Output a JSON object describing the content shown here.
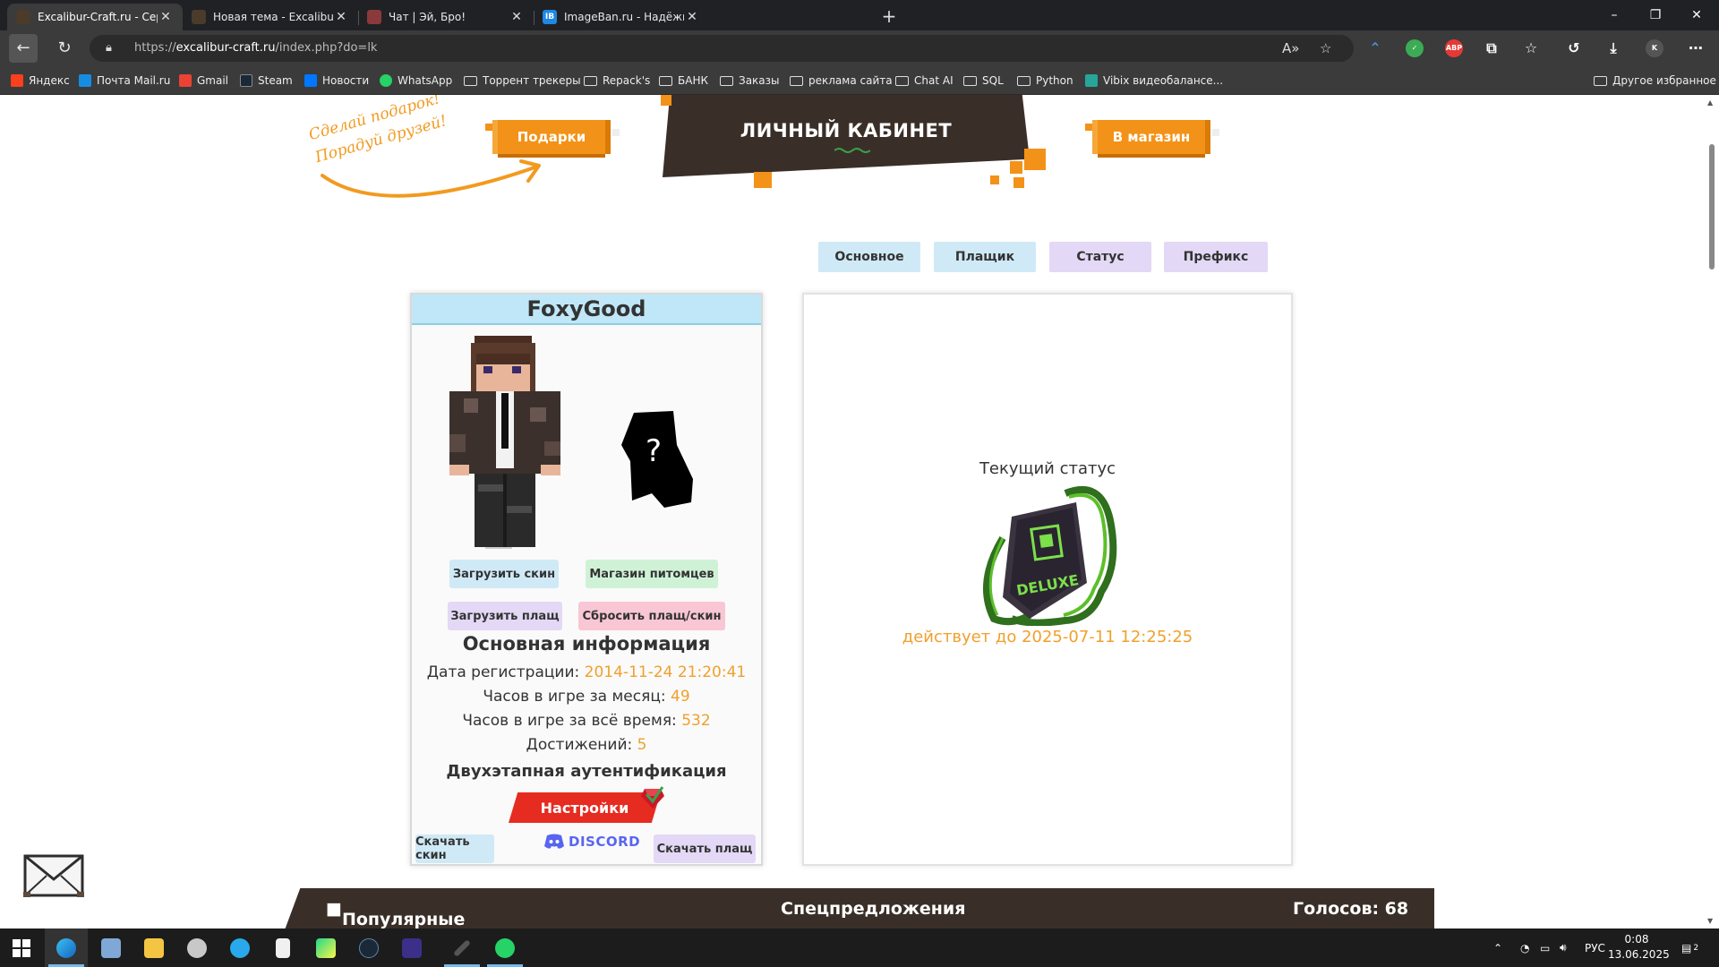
{
  "browser": {
    "tabs": [
      {
        "title": "Excalibur-Craft.ru - Сервера Mai",
        "active": true
      },
      {
        "title": "Новая тема - Excalibur Craft фор",
        "active": false
      },
      {
        "title": "Чат | Эй, Бро!",
        "active": false
      },
      {
        "title": "ImageBan.ru - Надёжный фотох",
        "active": false
      }
    ],
    "new_tab_glyph": "+",
    "window_controls": {
      "minimize": "–",
      "restore": "❐",
      "close": "✕"
    },
    "address": {
      "scheme": "https://",
      "host": "excalibur-craft.ru",
      "path": "/index.php?do=lk"
    },
    "bookmarks": [
      {
        "label": "Яндекс",
        "type": "site",
        "color": "#fc3f1d"
      },
      {
        "label": "Почта Mail.ru",
        "type": "site",
        "color": "#168de2"
      },
      {
        "label": "Gmail",
        "type": "site",
        "color": "#ea4335"
      },
      {
        "label": "Steam",
        "type": "site",
        "color": "#1b2838"
      },
      {
        "label": "Новости",
        "type": "site",
        "color": "#0077ff"
      },
      {
        "label": "WhatsApp",
        "type": "site",
        "color": "#25d366"
      },
      {
        "label": "Торрент трекеры",
        "type": "folder"
      },
      {
        "label": "Repack's",
        "type": "folder"
      },
      {
        "label": "БАНК",
        "type": "folder"
      },
      {
        "label": "Заказы",
        "type": "folder"
      },
      {
        "label": "реклама сайта",
        "type": "folder"
      },
      {
        "label": "Chat AI",
        "type": "folder"
      },
      {
        "label": "SQL",
        "type": "folder"
      },
      {
        "label": "Python",
        "type": "folder"
      },
      {
        "label": "Vibix видеобалансе...",
        "type": "site",
        "color": "#26a69a"
      }
    ],
    "other_favorites": "Другое избранное"
  },
  "page": {
    "promo_line1": "Сделай подарок!",
    "promo_line2": "Порадуй друзей!",
    "gifts_button": "Подарки",
    "cabinet_title": "ЛИЧНЫЙ КАБИНЕТ",
    "shop_button": "В магазин",
    "tabs": [
      {
        "label": "Основное",
        "color": "#cfeaf6"
      },
      {
        "label": "Плащик",
        "color": "#cfeaf6"
      },
      {
        "label": "Статус",
        "color": "#e3d8f5"
      },
      {
        "label": "Префикс",
        "color": "#e3d8f5"
      }
    ],
    "profile": {
      "username": "FoxyGood",
      "buttons": {
        "upload_skin": "Загрузить скин",
        "pet_shop": "Магазин питомцев",
        "upload_cloak": "Загрузить плащ",
        "reset": "Сбросить плащ/скин",
        "download_skin": "Скачать скин",
        "download_cloak": "Скачать плащ",
        "settings": "Настройки"
      },
      "pet_unknown_glyph": "?",
      "info_title": "Основная информация",
      "reg_label": "Дата регистрации:",
      "reg_value": "2014-11-24 21:20:41",
      "month_label": "Часов в игре за месяц:",
      "month_value": "49",
      "total_label": "Часов в игре за всё время:",
      "total_value": "532",
      "ach_label": "Достижений:",
      "ach_value": "5",
      "twofa_title": "Двухэтапная аутентификация",
      "discord_label": "DISCORD"
    },
    "status": {
      "title": "Текущий статус",
      "badge_text": "DELUXE",
      "until": "действует до 2025-07-11 12:25:25"
    },
    "bottom_bar": {
      "popular": "Популярные",
      "offers": "Спецпредложения",
      "votes": "Голосов: 68"
    }
  },
  "taskbar": {
    "apps": [
      "start",
      "edge",
      "explorer-alt",
      "file-explorer",
      "app-red",
      "telegram",
      "notepad",
      "pycharm",
      "steam",
      "visual-studio",
      "pen-tool",
      "whatsapp"
    ],
    "lang": "РУС",
    "time": "0:08",
    "date": "13.06.2025",
    "notifications": "2"
  }
}
